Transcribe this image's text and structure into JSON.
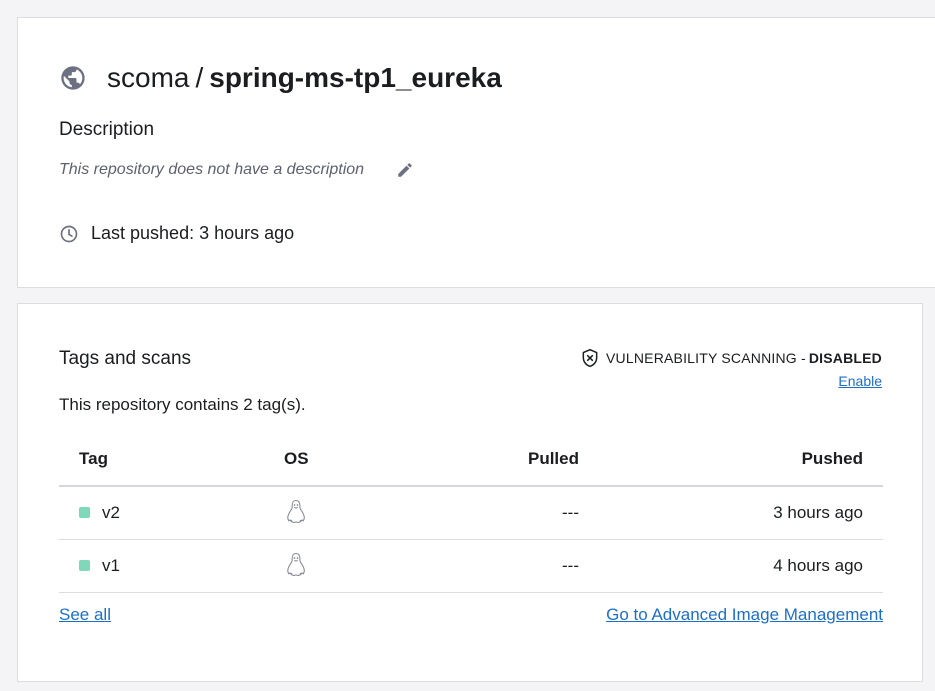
{
  "repo": {
    "namespace": "scoma",
    "separator": "/",
    "name": "spring-ms-tp1_eureka",
    "description_heading": "Description",
    "description_text": "This repository does not have a description",
    "last_pushed": "Last pushed: 3 hours ago"
  },
  "tags_section": {
    "heading": "Tags and scans",
    "vuln_label": "VULNERABILITY SCANNING - ",
    "vuln_status": "DISABLED",
    "enable_label": "Enable",
    "contains_text": "This repository contains 2 tag(s).",
    "columns": {
      "tag": "Tag",
      "os": "OS",
      "pulled": "Pulled",
      "pushed": "Pushed"
    },
    "rows": [
      {
        "tag": "v2",
        "os": "linux",
        "pulled": "---",
        "pushed": "3 hours ago"
      },
      {
        "tag": "v1",
        "os": "linux",
        "pulled": "---",
        "pushed": "4 hours ago"
      }
    ],
    "see_all_label": "See all",
    "advanced_label": "Go to Advanced Image Management"
  },
  "colors": {
    "link": "#1c6fc7",
    "tag_dot": "#7fd8b9",
    "icon_gray": "#6c7080"
  },
  "icons": [
    "globe-icon",
    "edit-icon",
    "clock-icon",
    "shield-x-icon",
    "linux-icon"
  ]
}
